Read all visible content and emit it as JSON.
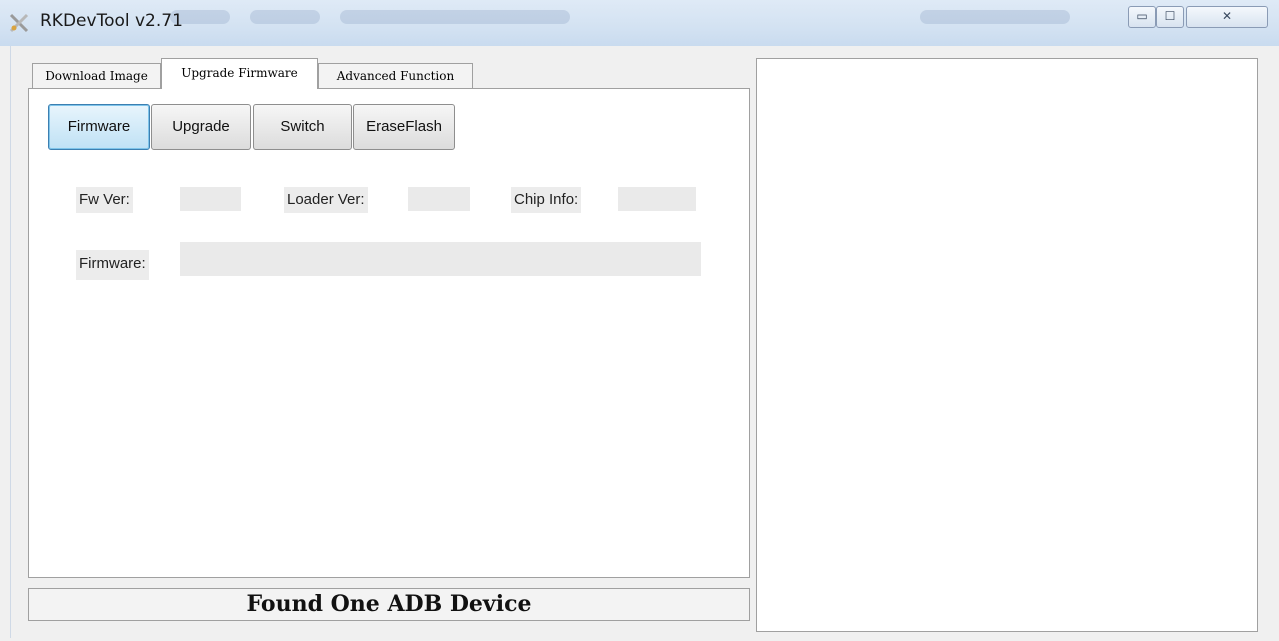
{
  "window": {
    "title": "RKDevTool v2.71",
    "controls": {
      "minimize": "▭",
      "maximize": "☐",
      "close": "✕"
    }
  },
  "tabs": [
    {
      "label": "Download Image",
      "active": false
    },
    {
      "label": "Upgrade Firmware",
      "active": true
    },
    {
      "label": "Advanced Function",
      "active": false
    }
  ],
  "toolbar": {
    "firmware_label": "Firmware",
    "upgrade_label": "Upgrade",
    "switch_label": "Switch",
    "eraseflash_label": "EraseFlash"
  },
  "info": {
    "fw_ver_label": "Fw Ver:",
    "fw_ver_value": "",
    "loader_ver_label": "Loader Ver:",
    "loader_ver_value": "",
    "chip_info_label": "Chip Info:",
    "chip_info_value": "",
    "firmware_label": "Firmware:",
    "firmware_value": ""
  },
  "status": {
    "text": "Found One ADB Device"
  },
  "log": {
    "text": ""
  },
  "colors": {
    "accent": "#bfe1f5",
    "titlebar": "#d3e2f2"
  }
}
